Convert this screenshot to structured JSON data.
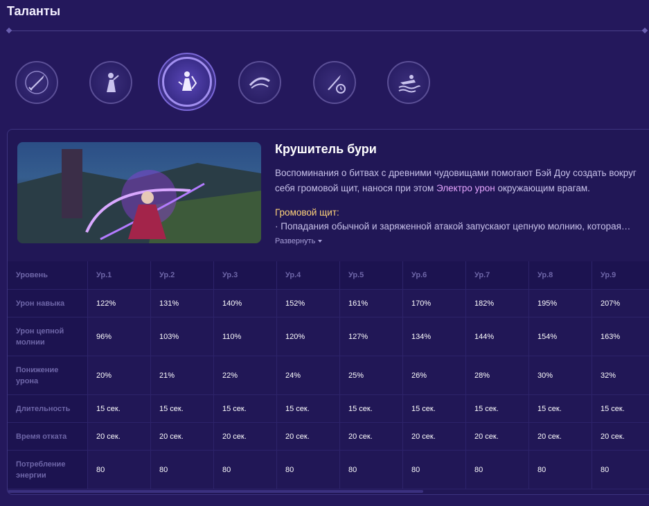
{
  "page": {
    "title": "Таланты"
  },
  "talents": [
    {
      "icon": "sword-icon"
    },
    {
      "icon": "figure-icon"
    },
    {
      "icon": "storm-icon"
    },
    {
      "icon": "wave-icon"
    },
    {
      "icon": "sword-timer-icon"
    },
    {
      "icon": "swim-icon"
    }
  ],
  "skill": {
    "title": "Крушитель бури",
    "desc_before": "Воспоминания о битвах с древними чудовищами помогают Бэй Доу создать вокруг себя громовой щит, нанося при этом ",
    "desc_highlight": "Электро урон",
    "desc_after": " окружающим врагам.",
    "sub_title": "Громовой щит:",
    "sub_line": "· Попадания обычной и заряженной атакой запускают цепную молнию, которая…",
    "expand": "Развернуть"
  },
  "table": {
    "header": [
      "Уровень",
      "Ур.1",
      "Ур.2",
      "Ур.3",
      "Ур.4",
      "Ур.5",
      "Ур.6",
      "Ур.7",
      "Ур.8",
      "Ур.9"
    ],
    "rows": [
      {
        "label": "Урон навыка",
        "values": [
          "122%",
          "131%",
          "140%",
          "152%",
          "161%",
          "170%",
          "182%",
          "195%",
          "207%"
        ]
      },
      {
        "label": "Урон цепной молнии",
        "values": [
          "96%",
          "103%",
          "110%",
          "120%",
          "127%",
          "134%",
          "144%",
          "154%",
          "163%"
        ]
      },
      {
        "label": "Понижение урона",
        "values": [
          "20%",
          "21%",
          "22%",
          "24%",
          "25%",
          "26%",
          "28%",
          "30%",
          "32%"
        ]
      },
      {
        "label": "Длительность",
        "values": [
          "15 сек.",
          "15 сек.",
          "15 сек.",
          "15 сек.",
          "15 сек.",
          "15 сек.",
          "15 сек.",
          "15 сек.",
          "15 сек."
        ]
      },
      {
        "label": "Время отката",
        "values": [
          "20 сек.",
          "20 сек.",
          "20 сек.",
          "20 сек.",
          "20 сек.",
          "20 сек.",
          "20 сек.",
          "20 сек.",
          "20 сек."
        ]
      },
      {
        "label": "Потребление энергии",
        "values": [
          "80",
          "80",
          "80",
          "80",
          "80",
          "80",
          "80",
          "80",
          "80"
        ]
      }
    ]
  },
  "colors": {
    "background": "#24185c",
    "highlight": "#e6a6ff",
    "subtitle": "#ffd37a"
  }
}
